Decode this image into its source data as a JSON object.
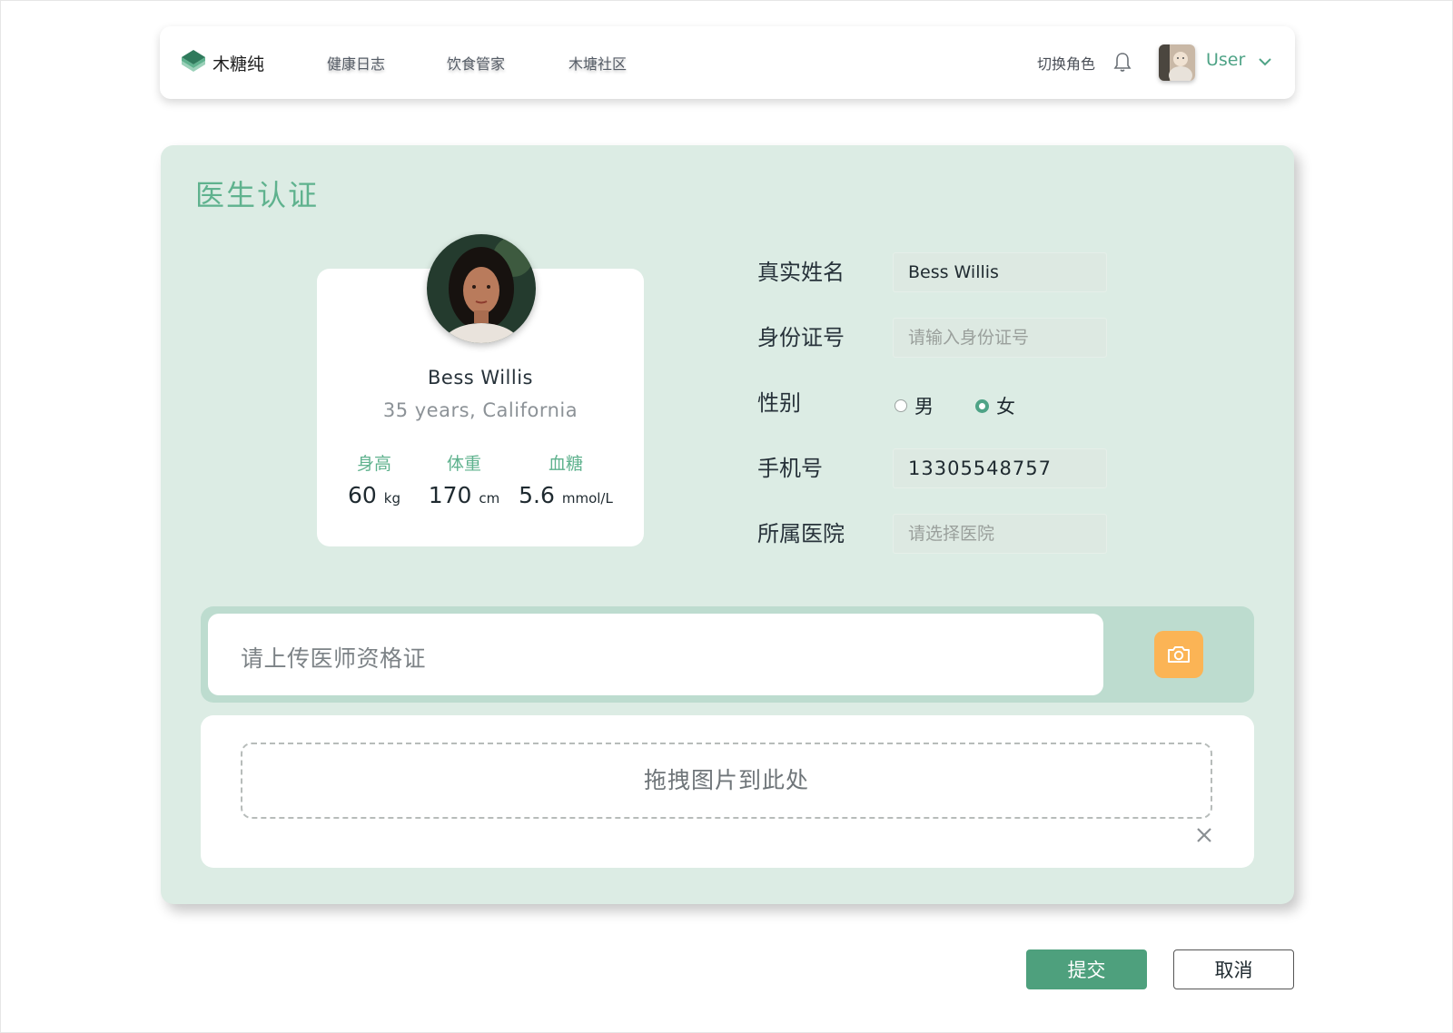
{
  "brand": {
    "name": "木糖纯",
    "icon": "layers-logo-icon",
    "accent": "#4ea386"
  },
  "nav": {
    "links": [
      "健康日志",
      "饮食管家",
      "木塘社区"
    ],
    "switch_role": "切换角色",
    "user_name": "User"
  },
  "page": {
    "title": "医生认证"
  },
  "profile": {
    "name": "Bess Willis",
    "subtitle": "35 years, California",
    "stats": [
      {
        "label": "身高",
        "value": "60",
        "unit": "kg"
      },
      {
        "label": "体重",
        "value": "170",
        "unit": "cm"
      },
      {
        "label": "血糖",
        "value": "5.6",
        "unit": "mmol/L"
      }
    ]
  },
  "form": {
    "name_label": "真实姓名",
    "name_value": "Bess Willis",
    "id_label": "身份证号",
    "id_placeholder": "请输入身份证号",
    "gender_label": "性别",
    "gender_options": [
      "男",
      "女"
    ],
    "gender_selected": "女",
    "phone_label": "手机号",
    "phone_value": "13305548757",
    "hospital_label": "所属医院",
    "hospital_placeholder": "请选择医院"
  },
  "upload": {
    "placeholder": "请上传医师资格证",
    "drop_text": "拖拽图片到此处",
    "camera_icon": "camera-icon",
    "button_color": "#fbb455"
  },
  "actions": {
    "submit": "提交",
    "cancel": "取消",
    "submit_color": "#4ea07d"
  }
}
